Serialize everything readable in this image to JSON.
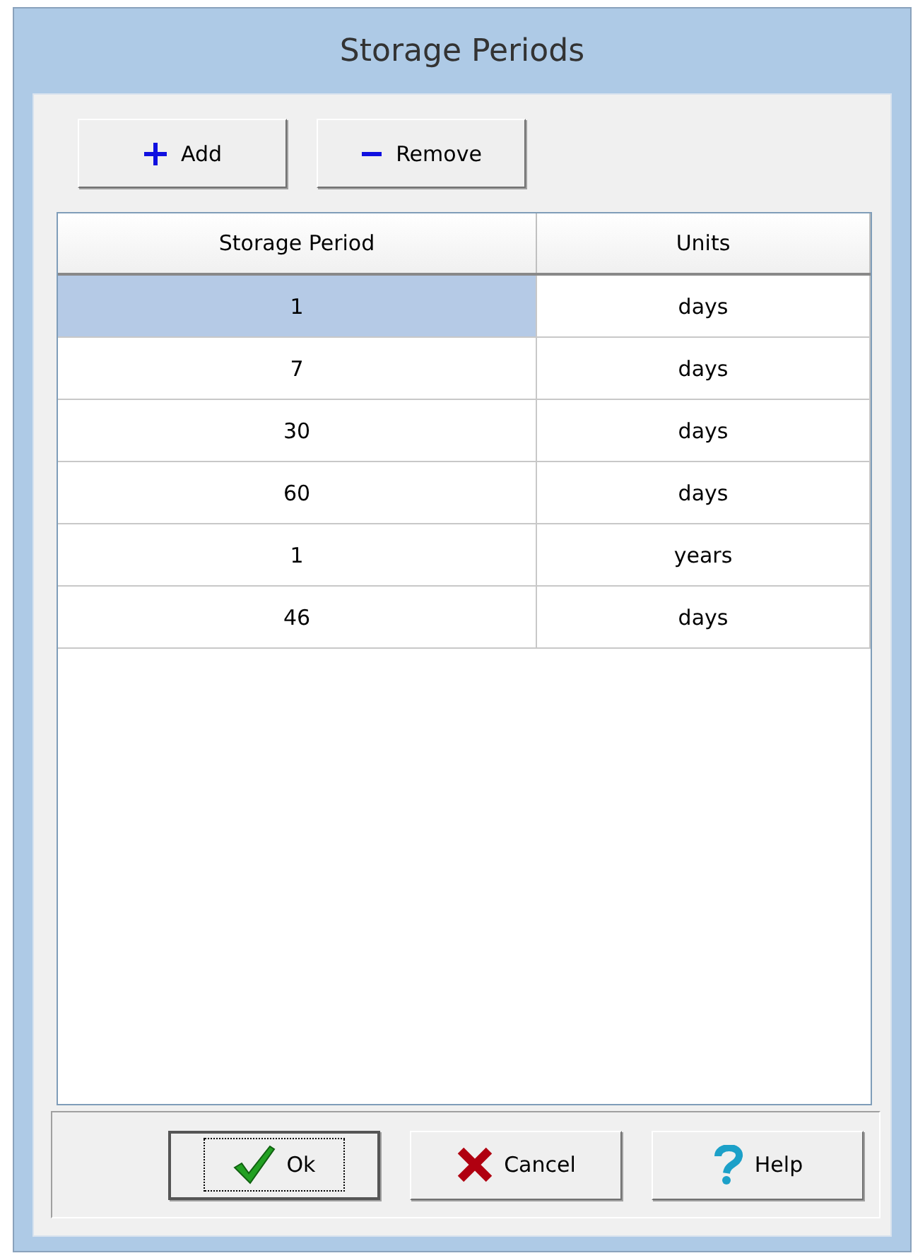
{
  "window": {
    "title": "Storage Periods"
  },
  "toolbar": [
    {
      "kind": "add",
      "label": "Add"
    },
    {
      "kind": "remove",
      "label": "Remove"
    }
  ],
  "table": {
    "columns": [
      "Storage Period",
      "Units"
    ],
    "rows": [
      {
        "cells": [
          "1",
          "days"
        ],
        "selected": true
      },
      {
        "cells": [
          "7",
          "days"
        ],
        "selected": false
      },
      {
        "cells": [
          "30",
          "days"
        ],
        "selected": false
      },
      {
        "cells": [
          "60",
          "days"
        ],
        "selected": false
      },
      {
        "cells": [
          "1",
          "years"
        ],
        "selected": false
      },
      {
        "cells": [
          "46",
          "days"
        ],
        "selected": false
      }
    ]
  },
  "buttons": [
    {
      "kind": "ok",
      "label": "Ok",
      "focused": true
    },
    {
      "kind": "cancel",
      "label": "Cancel",
      "focused": false
    },
    {
      "kind": "help",
      "label": "Help",
      "focused": false
    }
  ]
}
